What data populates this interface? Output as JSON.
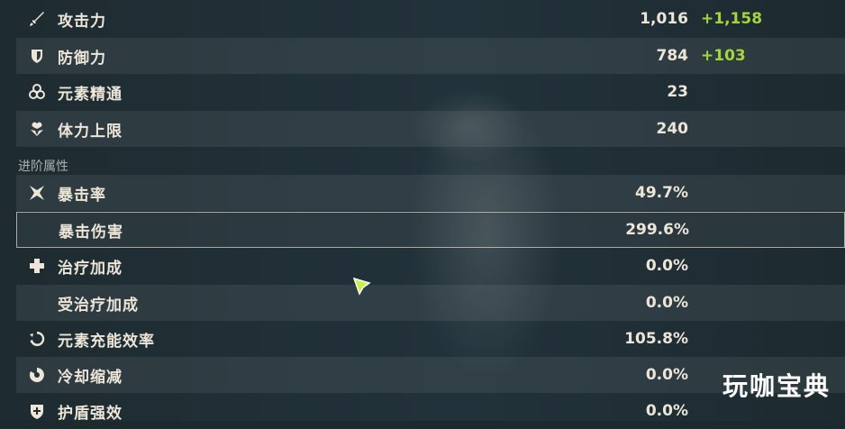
{
  "base_stats": [
    {
      "label": "攻击力",
      "value": "1,016",
      "bonus": "+1,158",
      "icon": "sword-icon"
    },
    {
      "label": "防御力",
      "value": "784",
      "bonus": "+103",
      "icon": "shield-icon"
    },
    {
      "label": "元素精通",
      "value": "23",
      "bonus": "",
      "icon": "elemental-mastery-icon"
    },
    {
      "label": "体力上限",
      "value": "240",
      "bonus": "",
      "icon": "hp-icon"
    }
  ],
  "advanced_section": {
    "title": "进阶属性"
  },
  "advanced_stats": [
    {
      "label": "暴击率",
      "value": "49.7%",
      "icon": "crit-rate-icon"
    },
    {
      "label": "暴击伤害",
      "value": "299.6%",
      "icon": ""
    },
    {
      "label": "治疗加成",
      "value": "0.0%",
      "icon": "healing-cross-icon"
    },
    {
      "label": "受治疗加成",
      "value": "0.0%",
      "icon": ""
    },
    {
      "label": "元素充能效率",
      "value": "105.8%",
      "icon": "energy-recharge-icon"
    },
    {
      "label": "冷却缩减",
      "value": "0.0%",
      "icon": "cooldown-icon"
    },
    {
      "label": "护盾强效",
      "value": "0.0%",
      "icon": "shield-strength-icon"
    }
  ],
  "watermark": "玩咖宝典",
  "colors": {
    "bonus": "#a6d43c",
    "text": "#ece5d8",
    "background": "#1c2a2e"
  }
}
